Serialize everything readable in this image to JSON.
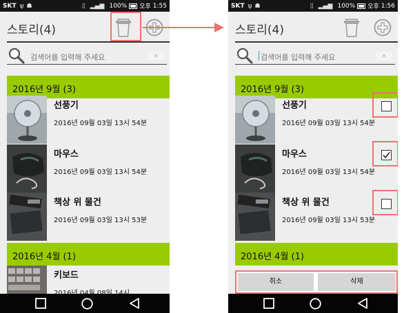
{
  "status": {
    "carrier": "SKT",
    "signal": "100%",
    "ampm": "오후",
    "time_left": "1:55",
    "time_right": "1:56"
  },
  "header": {
    "title": "스토리(4)"
  },
  "search": {
    "placeholder": "검색어를 입력해 주세요"
  },
  "sections": [
    {
      "label": "2016년 9월 (3)"
    },
    {
      "label": "2016년 4월 (1)"
    }
  ],
  "items": [
    {
      "name": "선풍기",
      "date": "2016년 09월 03일 13시 54분"
    },
    {
      "name": "마우스",
      "date": "2016년 09월 03일 13시 54분"
    },
    {
      "name": "책상 위 물건",
      "date": "2016년 09월 03일 13시 53분"
    },
    {
      "name": "키보드",
      "date": "2016년 04월 08일 14시"
    }
  ],
  "checkboxes": [
    false,
    true,
    false
  ],
  "actions": {
    "cancel": "취소",
    "delete": "삭제"
  },
  "colors": {
    "section_bg": "#99cc00",
    "highlight": "#f07070",
    "statusbar": "#161616"
  },
  "icons": [
    "trash-icon",
    "add-icon",
    "search-icon",
    "back-icon",
    "home-icon",
    "recent-apps-icon"
  ]
}
